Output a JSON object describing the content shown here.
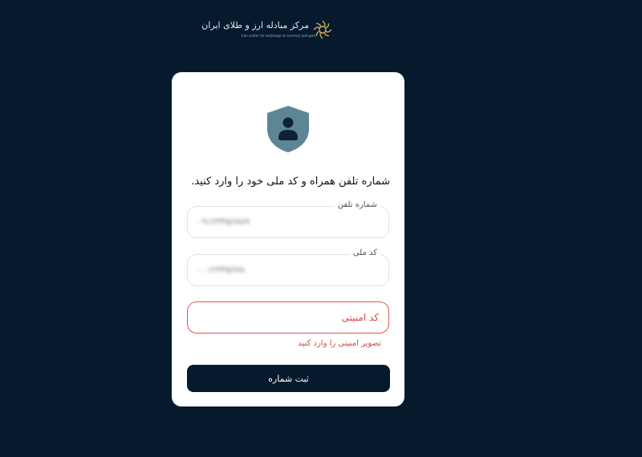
{
  "logo": {
    "title": "مرکز مبادله ارز و طلای ایران",
    "subtitle": "Iran center for exchange of currency and gold"
  },
  "card": {
    "instruction": "شماره تلفن همراه و کد ملی خود را وارد کنید.",
    "phone": {
      "label": "شماره تلفن",
      "value": "۰۹۱۲۳۴۵۶۷۸۹"
    },
    "national_code": {
      "label": "کد ملی",
      "value": "۰۰۱۲۳۴۵۶۷۸"
    },
    "captcha": {
      "placeholder": "کد امنیتی",
      "value": ""
    },
    "error": "تصویر امنیتی را وارد کنید",
    "submit_label": "ثبت شماره"
  },
  "colors": {
    "background": "#071a2d",
    "card": "#ffffff",
    "shield": "#5e8594",
    "error": "#d14b45",
    "button": "#071a2d"
  },
  "icons": {
    "logo": "logo-icon",
    "shield": "shield-user-icon"
  }
}
